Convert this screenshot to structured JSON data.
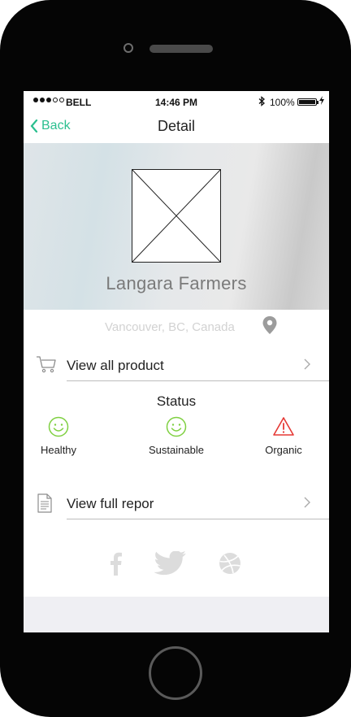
{
  "status_bar": {
    "carrier": "BELL",
    "time": "14:46 PM",
    "battery": "100%"
  },
  "nav": {
    "back_label": "Back",
    "title": "Detail"
  },
  "farm": {
    "name": "Langara Farmers",
    "location": "Vancouver, BC, Canada"
  },
  "rows": {
    "products": "View all product",
    "report": "View full repor"
  },
  "status": {
    "title": "Status",
    "items": [
      {
        "label": "Healthy",
        "icon": "smiley-icon",
        "color": "#7fd041"
      },
      {
        "label": "Sustainable",
        "icon": "smiley-icon",
        "color": "#7fd041"
      },
      {
        "label": "Organic",
        "icon": "warning-icon",
        "color": "#e53935"
      }
    ]
  },
  "social": [
    "facebook-icon",
    "twitter-icon",
    "dribbble-icon"
  ],
  "colors": {
    "accent": "#2bbf8f",
    "ok": "#7fd041",
    "warn": "#e53935"
  }
}
